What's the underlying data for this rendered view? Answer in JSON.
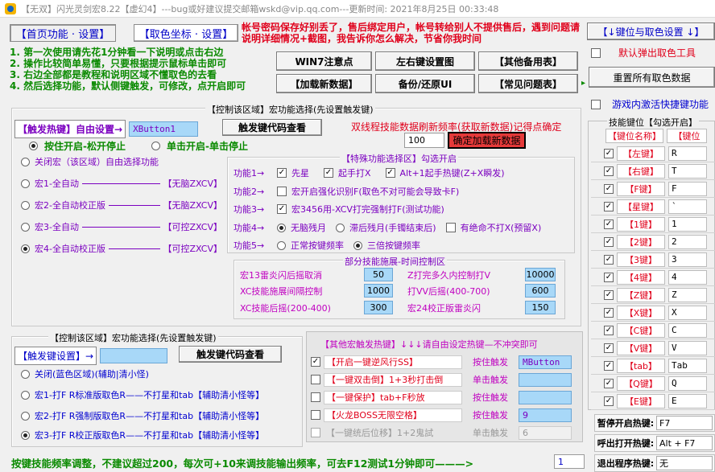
{
  "window": {
    "title": "【无双】闪光灵剑宏8.22【虚幻4】---bug或好建议提交邮箱wskd@vip.qq.com---更新时间: 2021年8月25日 00:33:48"
  },
  "tabs": [
    {
      "label": "【首页功能 · 设置】",
      "selected": true
    },
    {
      "label": "【取色坐标 · 设置】",
      "selected": false
    }
  ],
  "warning": "帐号密码保存好别丢了，售后绑定用户，帐号转给别人不提供售后，遇到问题请说明详细情况+截图，我告诉你怎么解决，节省你我时间",
  "instructions": [
    "1. 第一次使用请先花1分钟看一下说明或点击右边",
    "2. 操作比较简单易懂，只要根据提示鼠标单击即可",
    "3. 右边全部都是教程和说明区域不懂取色的去看",
    "4. 然后选择功能，默认侧键触发，可修改，点开启即可"
  ],
  "top_buttons": [
    "WIN7注意点",
    "左右键设置图",
    "【其他备用表】",
    "【加载新数据】",
    "备份/还原UI",
    "【常见问题表】"
  ],
  "right_top": {
    "keyset_button": "【↓键位与取色设置 ↓】",
    "popup_label": "默认弹出取色工具",
    "reset_button": "重置所有取色数据",
    "activate_label": "游戏内激活快捷键功能"
  },
  "macro_panel": {
    "title": "【控制该区域】宏功能选择(先设置触发键)",
    "trigger_label": "【触发热键】自由设置→",
    "trigger_value": "XButton1",
    "code_button": "触发键代码查看",
    "mode_hold": "按住开启-松开停止",
    "mode_click": "单击开启-单击停止",
    "options": [
      {
        "label": "关闭宏（该区域）自由选择功能",
        "tag": "",
        "selected": false
      },
      {
        "label": "宏1-全自动",
        "tag": "【无脑ZXCV】",
        "selected": false
      },
      {
        "label": "宏2-全自动校正版",
        "tag": "【无脑ZXCV】",
        "selected": false
      },
      {
        "label": "宏3-全自动",
        "tag": "【可控ZXCV】",
        "selected": false
      },
      {
        "label": "宏4-全自动校正版",
        "tag": "【可控ZXCV】",
        "selected": true
      }
    ],
    "freq_label": "双线程技能数据刷新频率(获取新数据)记得点确定",
    "freq_value": "100",
    "freq_button": "确定加载新数据"
  },
  "special": {
    "title": "【特殊功能选择区】勾选开启",
    "rows": [
      {
        "label": "功能1→",
        "items": [
          {
            "type": "check",
            "on": true,
            "text": "先星"
          },
          {
            "type": "check",
            "on": true,
            "text": "起手打X"
          },
          {
            "type": "check",
            "on": true,
            "text": "Alt+1起手热键(Z+X瞬发)"
          }
        ]
      },
      {
        "label": "功能2→",
        "items": [
          {
            "type": "check",
            "on": false,
            "text": "宏开启强化识别F(取色不对可能会导致卡F)"
          }
        ]
      },
      {
        "label": "功能3→",
        "items": [
          {
            "type": "check",
            "on": true,
            "text": "宏3456用-XCV打完强制打F(测试功能)"
          }
        ]
      },
      {
        "label": "功能4→",
        "items": [
          {
            "type": "radio",
            "on": true,
            "text": "无脑残月"
          },
          {
            "type": "radio",
            "on": false,
            "text": "滞后残月(手镯结束后)"
          },
          {
            "type": "check",
            "on": false,
            "text": "有绝命不打X(预留X)"
          }
        ]
      },
      {
        "label": "功能5→",
        "items": [
          {
            "type": "radio",
            "on": false,
            "text": "正常按键频率"
          },
          {
            "type": "radio",
            "on": true,
            "text": "三倍按键频率"
          }
        ]
      }
    ]
  },
  "timing": {
    "title": "部分技能施展-时间控制区",
    "items": [
      {
        "label": "宏13雷炎闪后摇取消",
        "value": "50"
      },
      {
        "label": "Z打完多久内控制打V",
        "value": "10000"
      },
      {
        "label": "XC技能施展间隔控制",
        "value": "1000"
      },
      {
        "label": "打VV后摇(400-700)",
        "value": "600"
      },
      {
        "label": "XC技能后摇(200-400)",
        "value": "300"
      },
      {
        "label": "宏24校正版雷炎闪",
        "value": "150"
      }
    ]
  },
  "lower_panel": {
    "title": "【控制该区域】宏功能选择(先设置触发键)",
    "trigger_label": "【触发键设置】→",
    "trigger_value": "",
    "code_button": "触发键代码查看",
    "options": [
      {
        "label": "关闭(蓝色区域)(辅助|清小怪)",
        "tag": "",
        "selected": false
      },
      {
        "label": "宏1-打F R标准版取色R——",
        "tag": "不打星和tab【辅助清小怪等】",
        "selected": false
      },
      {
        "label": "宏2-打F R强制版取色R——",
        "tag": "不打星和tab【辅助清小怪等】",
        "selected": false
      },
      {
        "label": "宏3-打F R校正版取色R——",
        "tag": "不打星和tab【辅助清小怪等】",
        "selected": true
      }
    ]
  },
  "other_hotkeys": {
    "title": "【其他宏触发热键】↓↓↓请自由设定热键—不冲突即可",
    "rows": [
      {
        "checked": true,
        "label": "【开启一键逆风行SS】",
        "action": "按住触发",
        "value": "MButton",
        "enabled": true
      },
      {
        "checked": false,
        "label": "【一键双击倒】1+3秒打击倒",
        "action": "单击触发",
        "value": "",
        "enabled": true
      },
      {
        "checked": false,
        "label": "【一键保护】tab+F秒放",
        "action": "按住触发",
        "value": "",
        "enabled": true
      },
      {
        "checked": false,
        "label": "【火龙BOSS无限空格】",
        "action": "按住触发",
        "value": "9",
        "enabled": true
      },
      {
        "checked": false,
        "label": "【一键统后位移】1+2鬼試",
        "action": "单击触发",
        "value": "6",
        "enabled": false
      }
    ]
  },
  "footer": {
    "text": "按键技能频率调整，不建议超过200，每次可+10来调技能输出频率，可去F12测试1分钟即可———>",
    "value": "1"
  },
  "key_panel": {
    "title": "技能键位【勾选开启】",
    "head_name": "【键位名称】",
    "head_key": "【键位",
    "rows": [
      {
        "name": "【左键】",
        "key": "R"
      },
      {
        "name": "【右键】",
        "key": "T"
      },
      {
        "name": "【F键】",
        "key": "F"
      },
      {
        "name": "【星键】",
        "key": "`"
      },
      {
        "name": "【1键】",
        "key": "1"
      },
      {
        "name": "【2键】",
        "key": "2"
      },
      {
        "name": "【3键】",
        "key": "3"
      },
      {
        "name": "【4键】",
        "key": "4"
      },
      {
        "name": "【Z键】",
        "key": "Z"
      },
      {
        "name": "【X键】",
        "key": "X"
      },
      {
        "name": "【C键】",
        "key": "C"
      },
      {
        "name": "【V键】",
        "key": "V"
      },
      {
        "name": "【tab】",
        "key": "Tab"
      },
      {
        "name": "【Q键】",
        "key": "Q"
      },
      {
        "name": "【E键】",
        "key": "E"
      }
    ],
    "hotkeys": [
      {
        "label": "暂停开启热键:",
        "value": "F7"
      },
      {
        "label": "呼出打开热键:",
        "value": "Alt + F7"
      },
      {
        "label": "退出程序热键:",
        "value": "无"
      }
    ]
  }
}
